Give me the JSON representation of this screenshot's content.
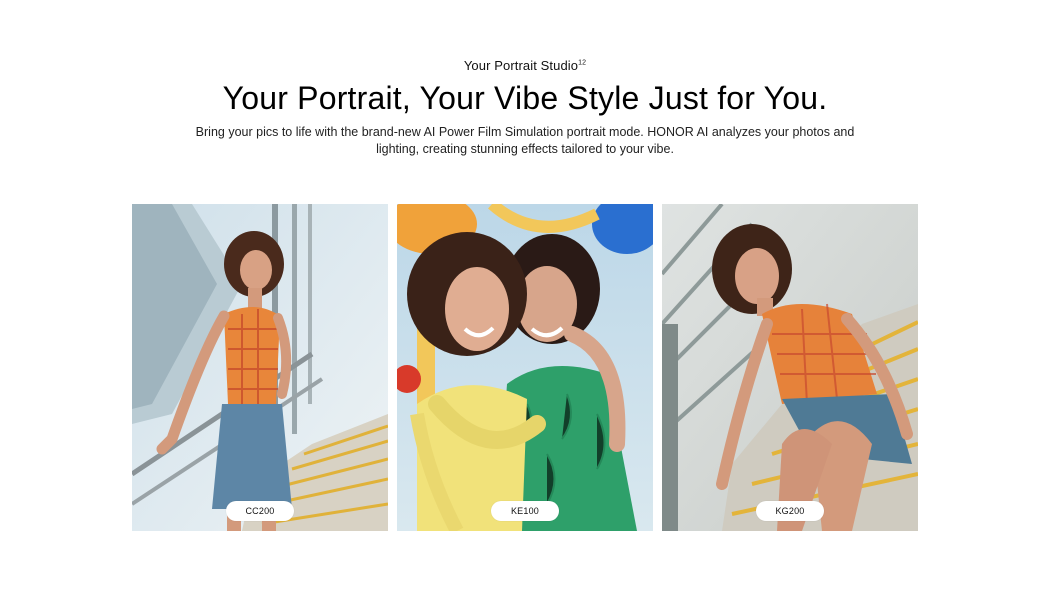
{
  "header": {
    "eyebrow": "Your Portrait Studio",
    "eyebrow_sup": "12",
    "headline": "Your Portrait, Your Vibe Style Just for You.",
    "description": "Bring your pics to life with the brand-new AI Power Film Simulation portrait mode. HONOR AI analyzes your photos and lighting, creating stunning effects tailored to your vibe."
  },
  "gallery": {
    "cards": [
      {
        "label": "CC200"
      },
      {
        "label": "KE100"
      },
      {
        "label": "KG200"
      }
    ]
  },
  "colors": {
    "background": "#ffffff",
    "pill_bg": "#ffffff",
    "text": "#000000"
  }
}
